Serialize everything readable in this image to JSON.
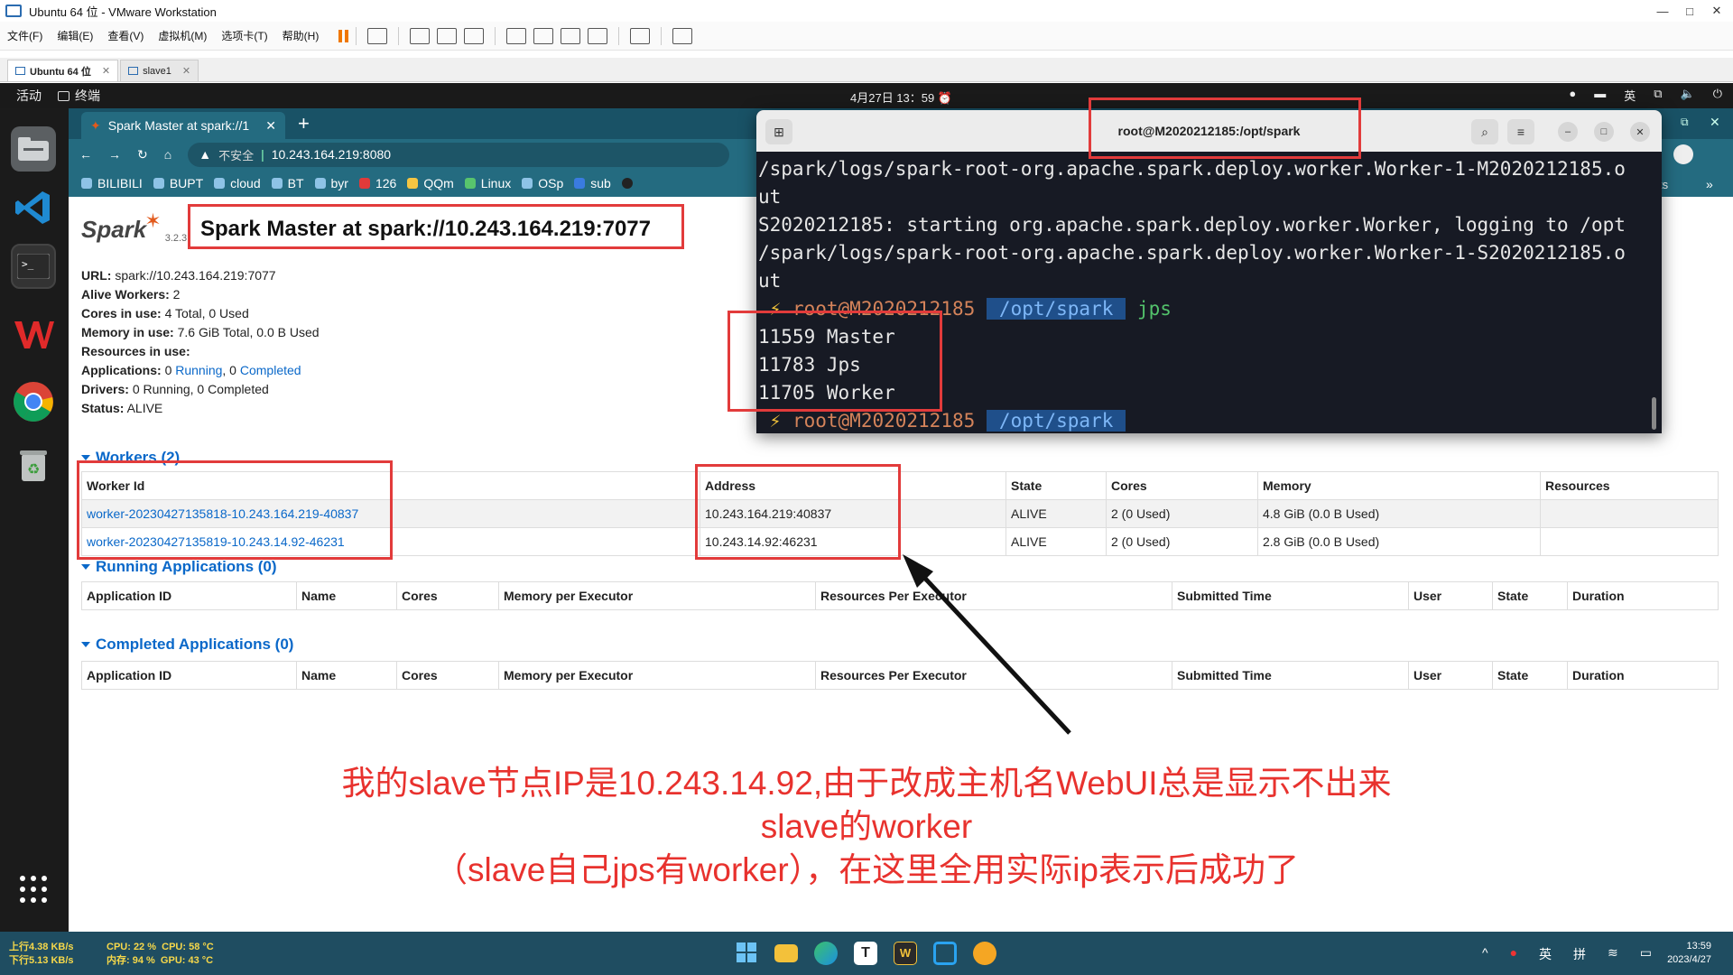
{
  "host": {
    "title": "Ubuntu 64 位 - VMware Workstation",
    "menus": [
      "文件(F)",
      "编辑(E)",
      "查看(V)",
      "虚拟机(M)",
      "选项卡(T)",
      "帮助(H)"
    ],
    "tabs": [
      {
        "label": "Ubuntu 64 位",
        "active": true
      },
      {
        "label": "slave1",
        "active": false
      }
    ]
  },
  "gnome": {
    "activities": "活动",
    "app_name": "终端",
    "clock": "4月27日  13：59",
    "input_method": "英"
  },
  "browser": {
    "tab_title": "Spark Master at spark://1",
    "insecure_label": "不安全",
    "url": "10.243.164.219:8080",
    "bookmarks": [
      "BILIBILI",
      "BUPT",
      "cloud",
      "BT",
      "byr",
      "126",
      "QQm",
      "Linux",
      "OSp",
      "sub"
    ],
    "bookmarks_overflow": "ts"
  },
  "spark": {
    "logo_word": "Spark",
    "version": "3.2.3",
    "title": "Spark Master at spark://10.243.164.219:7077",
    "summary": {
      "url_label": "URL:",
      "url_value": "spark://10.243.164.219:7077",
      "alive_label": "Alive Workers:",
      "alive_value": "2",
      "cores_label": "Cores in use:",
      "cores_value": "4 Total, 0 Used",
      "memory_label": "Memory in use:",
      "memory_value": "7.6 GiB Total, 0.0 B Used",
      "resources_label": "Resources in use:",
      "apps_label": "Applications:",
      "apps_running_count": "0",
      "apps_running_link": "Running",
      "apps_sep": ", 0",
      "apps_completed_link": "Completed",
      "drivers_label": "Drivers:",
      "drivers_value": "0 Running, 0 Completed",
      "status_label": "Status:",
      "status_value": "ALIVE"
    },
    "workers_heading": "Workers (2)",
    "workers_columns": [
      "Worker Id",
      "Address",
      "State",
      "Cores",
      "Memory",
      "Resources"
    ],
    "workers": [
      {
        "id": "worker-20230427135818-10.243.164.219-40837",
        "address": "10.243.164.219:40837",
        "state": "ALIVE",
        "cores": "2 (0 Used)",
        "memory": "4.8 GiB (0.0 B Used)",
        "resources": ""
      },
      {
        "id": "worker-20230427135819-10.243.14.92-46231",
        "address": "10.243.14.92:46231",
        "state": "ALIVE",
        "cores": "2 (0 Used)",
        "memory": "2.8 GiB (0.0 B Used)",
        "resources": ""
      }
    ],
    "running_heading": "Running Applications (0)",
    "completed_heading": "Completed Applications (0)",
    "app_columns": [
      "Application ID",
      "Name",
      "Cores",
      "Memory per Executor",
      "Resources Per Executor",
      "Submitted Time",
      "User",
      "State",
      "Duration"
    ]
  },
  "terminal": {
    "title": "root@M2020212185:/opt/spark",
    "lines": [
      "/spark/logs/spark-root-org.apache.spark.deploy.worker.Worker-1-M2020212185.o",
      "ut",
      "S2020212185: starting org.apache.spark.deploy.worker.Worker, logging to /opt",
      "/spark/logs/spark-root-org.apache.spark.deploy.worker.Worker-1-S2020212185.o",
      "ut"
    ],
    "prompt_bolt": "⚡",
    "prompt_user": "root@M2020212185",
    "prompt_path": "/opt/spark",
    "command": "jps",
    "output": [
      "11559 Master",
      "11783 Jps",
      "11705 Worker"
    ]
  },
  "annotation": {
    "line1": "我的slave节点IP是10.243.14.92,由于改成主机名WebUI总是显示不出来slave的worker",
    "line2": "（slave自己jps有worker），在这里全用实际ip表示后成功了",
    "color": "#e8322e"
  },
  "taskbar": {
    "net_up": "上行4.38 KB/s",
    "net_down": "下行5.13 KB/s",
    "cpu": "CPU: 22 %",
    "cpu_temp": "CPU: 58 °C",
    "mem": "内存: 94 %",
    "gpu_temp": "GPU: 43 °C",
    "ime1": "英",
    "ime2": "拼",
    "time": "13:59",
    "date": "2023/4/27"
  }
}
